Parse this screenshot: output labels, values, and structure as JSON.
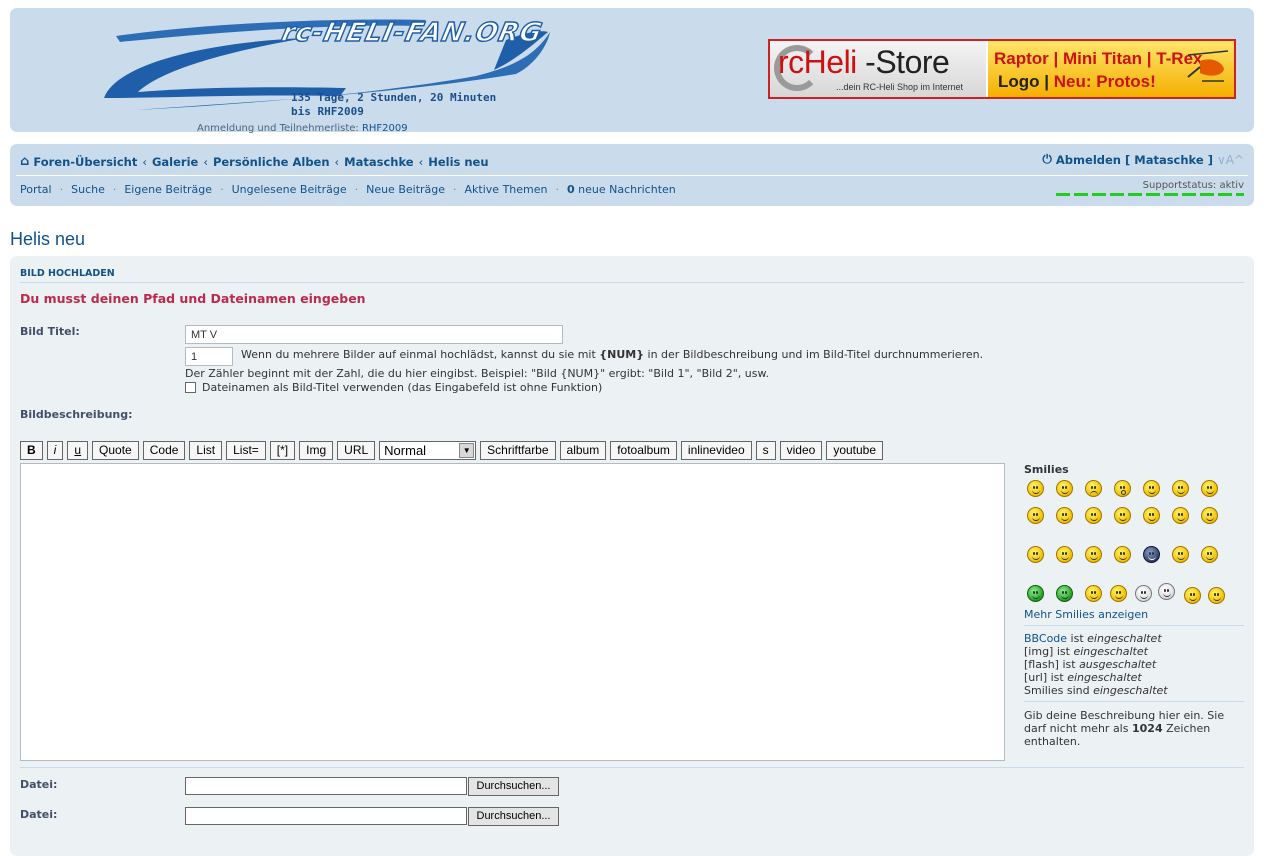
{
  "header": {
    "logo_text": "rc-HELI-FAN.ORG",
    "countdown_line1": "135 Tage, 2 Stunden, 20 Minuten",
    "countdown_line2": "bis RHF2009",
    "anmeldung_label": "Anmeldung und Teilnehmerliste:",
    "anmeldung_link": "RHF2009",
    "banner": {
      "title_a": "rcHeli",
      "title_b": " -Store",
      "subtitle": "...dein RC-Heli Shop im Internet",
      "line1": "Raptor | Mini Titan | T-Rex",
      "line2_a": "Logo | ",
      "line2_b": "Neu: Protos!"
    }
  },
  "navbar": {
    "breadcrumbs": [
      "Foren-Übersicht",
      "Galerie",
      "Persönliche Alben",
      "Mataschke",
      "Helis neu"
    ],
    "logout": "Abmelden [ Mataschke ]",
    "fontsize": "∨A^",
    "quicklinks": [
      "Portal",
      "Suche",
      "Eigene Beiträge",
      "Ungelesene Beiträge",
      "Neue Beiträge",
      "Aktive Themen"
    ],
    "messages_count": "0",
    "messages_label": " neue Nachrichten",
    "support_status": "Supportstatus: aktiv"
  },
  "page": {
    "title": "Helis neu",
    "panel_heading": "BILD HOCHLADEN",
    "error": "Du musst deinen Pfad und Dateinamen eingeben"
  },
  "form": {
    "title_label": "Bild Titel:",
    "title_value": "MT V",
    "counter_value": "1",
    "counter_hint_a": "Wenn du mehrere Bilder auf einmal hochlädst, kannst du sie mit ",
    "counter_hint_num": "{NUM}",
    "counter_hint_b": " in der Bildbeschreibung und im Bild-Titel durchnummerieren.",
    "counter_hint2": "Der Zähler beginnt mit der Zahl, die du hier eingibst. Beispiel: \"Bild {NUM}\" ergibt: \"Bild 1\", \"Bild 2\", usw.",
    "filename_checkbox": "Dateinamen als Bild-Titel verwenden (das Eingabefeld ist ohne Funktion)",
    "description_label": "Bildbeschreibung:",
    "toolbar": [
      "B",
      "i",
      "u",
      "Quote",
      "Code",
      "List",
      "List=",
      "[*]",
      "Img",
      "URL"
    ],
    "fontsize_select": "Normal",
    "toolbar2": [
      "Schriftfarbe",
      "album",
      "fotoalbum",
      "inlinevideo",
      "s",
      "video",
      "youtube"
    ],
    "file_label": "Datei:",
    "browse_label": "Durchsuchen..."
  },
  "sidebar": {
    "smilies_title": "Smilies",
    "more_smilies": "Mehr Smilies anzeigen",
    "bbcode_link": "BBCode",
    "bbcode_rest": " ist ",
    "bbcode_state": "eingeschaltet",
    "img_a": "[img] ist ",
    "img_state": "eingeschaltet",
    "flash_a": "[flash] ist ",
    "flash_state": "ausgeschaltet",
    "url_a": "[url] ist ",
    "url_state": "eingeschaltet",
    "smilies_a": "Smilies sind ",
    "smilies_state": "eingeschaltet",
    "desc_hint_a": "Gib deine Beschreibung hier ein. Sie darf nicht mehr als ",
    "desc_hint_num": "1024",
    "desc_hint_b": " Zeichen enthalten."
  }
}
